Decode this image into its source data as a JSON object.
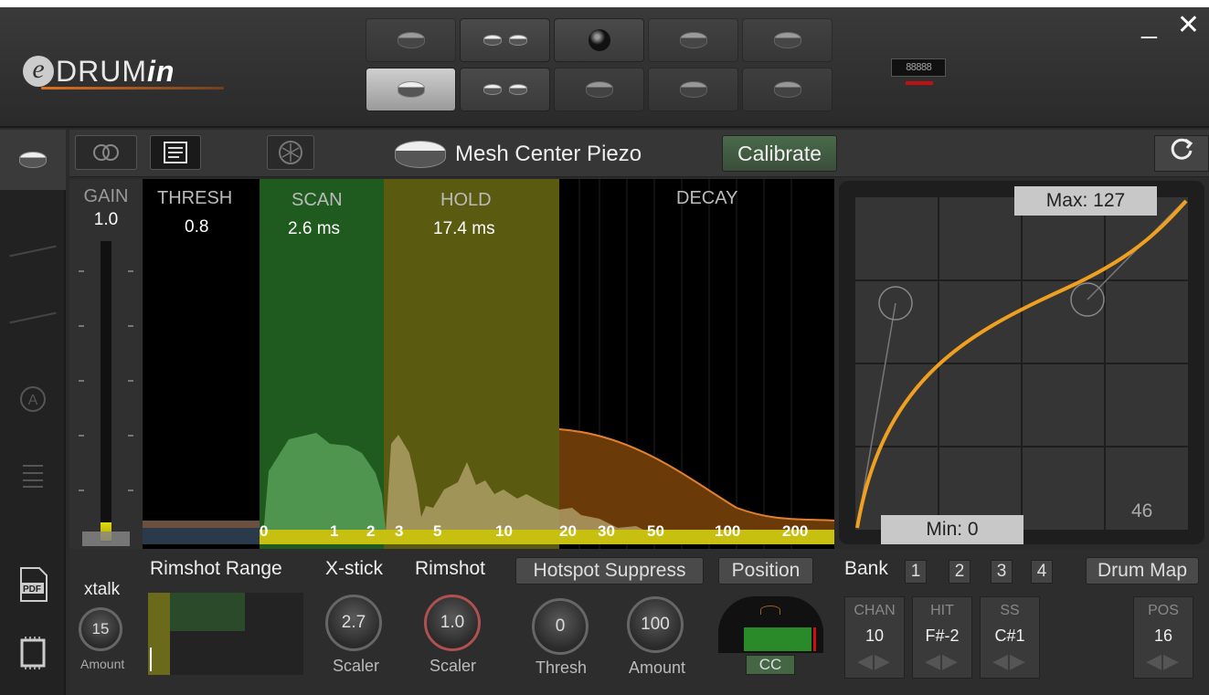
{
  "logo": {
    "prefix": "e",
    "main": "DRUM",
    "suffix": "in"
  },
  "window": {
    "minimize": "_",
    "close": "✕"
  },
  "midi_port": {
    "label": "88888"
  },
  "toolbar": {
    "pad_name": "Mesh Center Piezo",
    "calibrate": "Calibrate",
    "reset": "C"
  },
  "gain": {
    "label": "GAIN",
    "value": "1.0"
  },
  "zones": {
    "thresh": {
      "label": "THRESH",
      "value": "0.8"
    },
    "scan": {
      "label": "SCAN",
      "value": "2.6 ms"
    },
    "hold": {
      "label": "HOLD",
      "value": "17.4 ms"
    },
    "decay": {
      "label": "DECAY"
    }
  },
  "time_axis": [
    "0",
    "1",
    "2",
    "3",
    "5",
    "10",
    "20",
    "30",
    "50",
    "100",
    "200"
  ],
  "curve": {
    "max": "Max: 127",
    "min": "Min: 0",
    "value": "46"
  },
  "sidebar": {
    "pdf": "PDF"
  },
  "xtalk": {
    "label": "xtalk",
    "value": "15",
    "sub": "Amount"
  },
  "rimshot_range": {
    "label": "Rimshot Range"
  },
  "xstick": {
    "label": "X-stick",
    "value": "2.7",
    "sub": "Scaler"
  },
  "rimshot": {
    "label": "Rimshot",
    "value": "1.0",
    "sub": "Scaler"
  },
  "hotspot": {
    "label": "Hotspot Suppress",
    "thresh": "0",
    "thresh_sub": "Thresh",
    "amount": "100",
    "amount_sub": "Amount"
  },
  "position": {
    "label": "Position",
    "cc": "CC"
  },
  "bank": {
    "label": "Bank",
    "buttons": [
      "1",
      "2",
      "3",
      "4"
    ],
    "drum_map": "Drum Map",
    "cells": [
      {
        "h": "CHAN",
        "v": "10"
      },
      {
        "h": "HIT",
        "v": "F#-2"
      },
      {
        "h": "SS",
        "v": "C#1"
      },
      {
        "h": "POS",
        "v": "16"
      }
    ]
  },
  "colors": {
    "scan": "#1f5a1f",
    "hold": "#5a5a10",
    "decay": "#6a3a08",
    "curve": "#f0a020"
  }
}
